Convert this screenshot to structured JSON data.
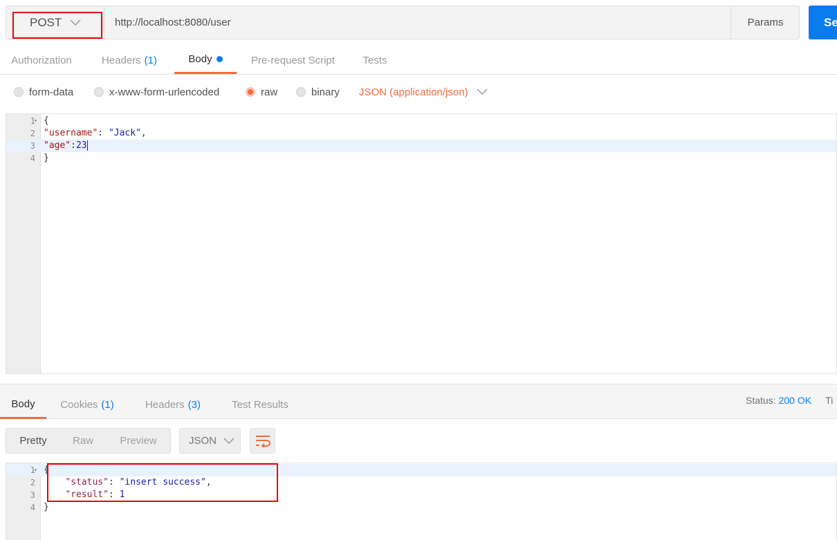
{
  "request": {
    "method": "POST",
    "url": "http://localhost:8080/user",
    "params_label": "Params",
    "send_label": "Se"
  },
  "request_tabs": [
    {
      "label": "Authorization"
    },
    {
      "label": "Headers",
      "count": "(1)"
    },
    {
      "label": "Body",
      "active": true
    },
    {
      "label": "Pre-request Script"
    },
    {
      "label": "Tests"
    }
  ],
  "body_types": [
    {
      "label": "form-data"
    },
    {
      "label": "x-www-form-urlencoded"
    },
    {
      "label": "raw",
      "checked": true
    },
    {
      "label": "binary"
    }
  ],
  "content_type": "JSON (application/json)",
  "request_body": {
    "lines": [
      {
        "num": "1",
        "fold": "▾",
        "text": "{"
      },
      {
        "num": "2",
        "key": "\"username\"",
        "sep": ": ",
        "value": "\"Jack\"",
        "tail": ","
      },
      {
        "num": "3",
        "key": "\"age\"",
        "sep": ":",
        "value": "23"
      },
      {
        "num": "4",
        "text": "}"
      }
    ]
  },
  "response_tabs": [
    {
      "label": "Body",
      "active": true
    },
    {
      "label": "Cookies",
      "count": "(1)"
    },
    {
      "label": "Headers",
      "count": "(3)"
    },
    {
      "label": "Test Results"
    }
  ],
  "status": {
    "label": "Status:",
    "code": "200 OK",
    "time_label": "Ti"
  },
  "view_modes": [
    "Pretty",
    "Raw",
    "Preview"
  ],
  "format": "JSON",
  "response_body": {
    "lines": [
      {
        "num": "1",
        "fold": "▾",
        "text": "{"
      },
      {
        "num": "2",
        "indent": "    ",
        "key": "\"status\"",
        "sep": ": ",
        "value": "\"insert success\"",
        "tail": ","
      },
      {
        "num": "3",
        "indent": "    ",
        "key": "\"result\"",
        "sep": ": ",
        "value": "1"
      },
      {
        "num": "4",
        "text": "}"
      }
    ]
  },
  "colors": {
    "accent": "#f26b3a",
    "link": "#097bed",
    "highlight_box": "#ee0000"
  }
}
